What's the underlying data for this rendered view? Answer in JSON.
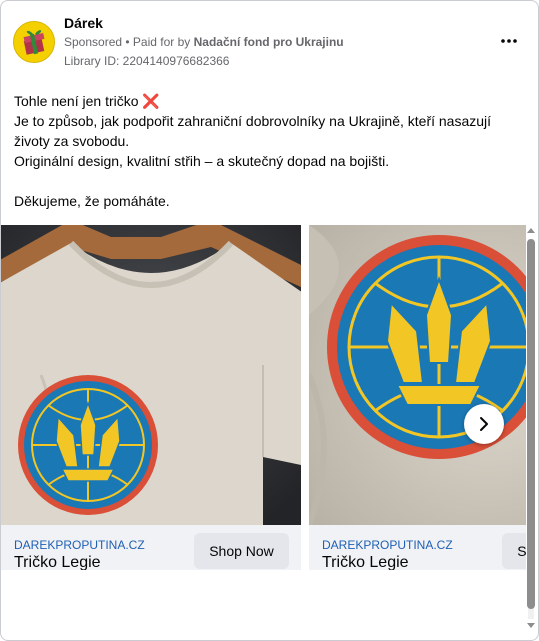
{
  "post": {
    "page_name": "Dárek",
    "sponsored_label": "Sponsored",
    "paid_for_prefix": " • Paid for by ",
    "paid_for_org": "Nadační fond pro Ukrajinu",
    "library_id": "Library ID: 2204140976682366",
    "body_lines": [
      "Tohle není jen tričko ❌",
      "Je to způsob, jak podpořit zahraniční dobrovolníky na Ukrajině, kteří nasazují životy za svobodu.",
      "Originální design, kvalitní střih – a skutečný dopad na bojišti.",
      "",
      "Děkujeme, že pomáháte."
    ]
  },
  "carousel": {
    "cards": [
      {
        "domain": "DAREKPROPUTINA.CZ",
        "title": "Tričko Legie",
        "cta": "Shop Now"
      },
      {
        "domain": "DAREKPROPUTINA.CZ",
        "title": "Tričko Legie",
        "cta": "Shop Now"
      }
    ]
  },
  "icons": {
    "more": "more-horizontal-icon",
    "next": "chevron-right-icon",
    "avatar": "gift-box-icon",
    "cross": "cross-mark-emoji"
  },
  "colors": {
    "link_blue": "#1f5fb4",
    "button_grey": "#e4e6eb",
    "footer_grey": "#f0f2f5",
    "emblem_blue": "#1a78b5",
    "emblem_yellow": "#f2c624",
    "emblem_red": "#d94f37",
    "shirt_beige": "#dcd6cc"
  }
}
